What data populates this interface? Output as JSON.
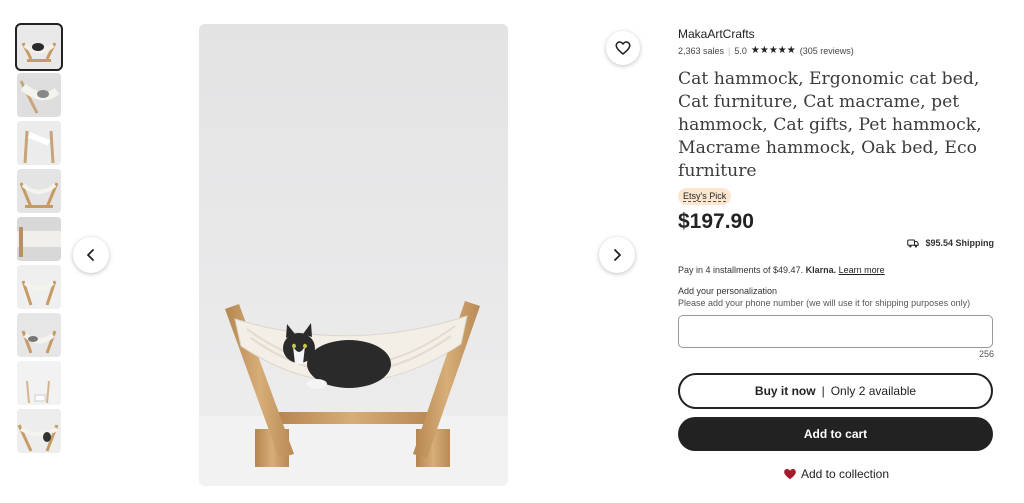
{
  "gallery": {
    "thumbnails": [
      {
        "label": "thumbnail-1",
        "selected": true
      },
      {
        "label": "thumbnail-2",
        "selected": false
      },
      {
        "label": "thumbnail-3",
        "selected": false
      },
      {
        "label": "thumbnail-4",
        "selected": false
      },
      {
        "label": "thumbnail-5",
        "selected": false
      },
      {
        "label": "thumbnail-6",
        "selected": false
      },
      {
        "label": "thumbnail-7",
        "selected": false
      },
      {
        "label": "thumbnail-8",
        "selected": false
      },
      {
        "label": "thumbnail-9",
        "selected": false
      }
    ],
    "icons": {
      "prev": "chevron-left-icon",
      "next": "chevron-right-icon",
      "favorite": "heart-outline-icon"
    }
  },
  "listing": {
    "shop_name": "MakaArtCrafts",
    "sales": "2,363 sales",
    "rating": "5.0",
    "stars": "★★★★★",
    "reviews": "(305 reviews)",
    "title": "Cat hammock, Ergonomic cat bed, Cat furniture, Cat macrame, pet hammock, Cat gifts, Pet hammock, Macrame hammock, Oak bed, Eco furniture",
    "badge": "Etsy's Pick",
    "price": "$197.90",
    "shipping": "$95.54 Shipping",
    "klarna_text": "Pay in 4 installments of $49.47.",
    "klarna_brand": "Klarna.",
    "klarna_link": "Learn more"
  },
  "personalization": {
    "label": "Add your personalization",
    "help": "Please add your phone number (we will use it for shipping purposes only)",
    "value": "",
    "char_count": "256"
  },
  "actions": {
    "buy_now": "Buy it now",
    "buy_sep": "|",
    "availability": "Only 2 available",
    "add_to_cart": "Add to cart",
    "add_to_collection": "Add to collection"
  },
  "colors": {
    "badge_bg": "#fde6cf",
    "button_dark": "#222222",
    "heart": "#a61a2e"
  }
}
